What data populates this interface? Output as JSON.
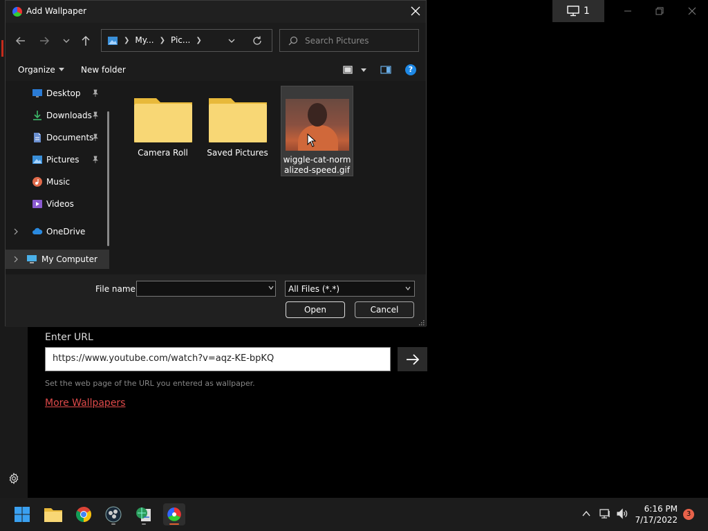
{
  "dialog": {
    "title": "Add Wallpaper",
    "breadcrumbs": [
      "My...",
      "Pic..."
    ],
    "search_placeholder": "Search Pictures",
    "organize_label": "Organize",
    "new_folder_label": "New folder",
    "nav_items": [
      {
        "label": "Desktop",
        "icon": "desktop-icon",
        "pinned": true
      },
      {
        "label": "Downloads",
        "icon": "download-icon",
        "pinned": true
      },
      {
        "label": "Documents",
        "icon": "documents-icon",
        "pinned": true
      },
      {
        "label": "Pictures",
        "icon": "pictures-icon",
        "pinned": true
      },
      {
        "label": "Music",
        "icon": "music-icon",
        "pinned": false
      },
      {
        "label": "Videos",
        "icon": "videos-icon",
        "pinned": false
      },
      {
        "label": "OneDrive",
        "icon": "cloud-icon",
        "pinned": false
      },
      {
        "label": "My Computer",
        "icon": "computer-icon",
        "pinned": false
      }
    ],
    "files": [
      {
        "name": "Camera Roll",
        "type": "folder"
      },
      {
        "name": "Saved Pictures",
        "type": "folder"
      },
      {
        "name": "wiggle-cat-normalized-speed.gif",
        "name_line1": "wiggle-cat-norm",
        "name_line2": "alized-speed.gif",
        "type": "image"
      }
    ],
    "file_name_label": "File name:",
    "file_name_value": "",
    "file_type_value": "All Files (*.*)",
    "open_label": "Open",
    "cancel_label": "Cancel"
  },
  "app": {
    "monitor_count": "1",
    "url_label": "Enter URL",
    "url_value": "https://www.youtube.com/watch?v=aqz-KE-bpKQ",
    "url_hint": "Set the web page of the URL you entered as wallpaper.",
    "more_link": "More Wallpapers"
  },
  "taskbar": {
    "time": "6:16 PM",
    "date": "7/17/2022",
    "notification_count": "3"
  },
  "colors": {
    "accent_red": "#e04a4a",
    "folder_yellow": "#f8d775",
    "help_blue": "#1e88e5"
  }
}
